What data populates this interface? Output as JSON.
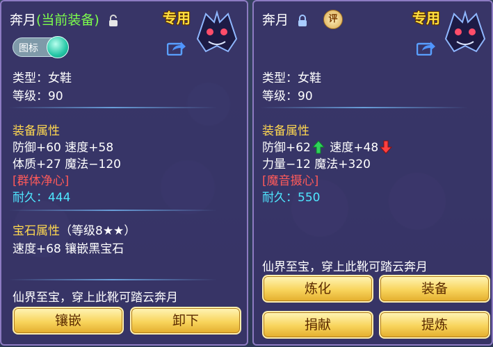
{
  "colors": {
    "panel": "#383468",
    "green_name": "#7dff4c",
    "yellow": "#ffd850",
    "red": "#ff5a5a",
    "cyan": "#4fe6ff",
    "button": "#f8d45c"
  },
  "left": {
    "name": "奔月",
    "current_tag": "(当前装备)",
    "badge": "专用",
    "toggle_label": "图标",
    "type": "类型：女鞋",
    "level": "等级：90",
    "attr_header": "装备属性",
    "stat1": "防御+60 速度+58",
    "stat2": "体质+27 魔法−120",
    "special": "[群体净心]",
    "durability": "耐久：444",
    "gem_header": "宝石属性",
    "gem_level": "（等级8★★）",
    "gem_stat": "速度+68 镶嵌黑宝石",
    "description": "仙界至宝，穿上此靴可踏云奔月",
    "buttons": [
      "镶嵌",
      "卸下"
    ]
  },
  "right": {
    "name": "奔月",
    "rate_icon": "评",
    "badge": "专用",
    "type": "类型：女鞋",
    "level": "等级：90",
    "attr_header": "装备属性",
    "stat1a": "防御+62",
    "stat1b": "速度+48",
    "stat2": "力量−12 魔法+320",
    "special": "[魔音摄心]",
    "durability": "耐久：550",
    "description": "仙界至宝，穿上此靴可踏云奔月",
    "buttons": [
      "炼化",
      "装备",
      "捐献",
      "提炼"
    ]
  }
}
